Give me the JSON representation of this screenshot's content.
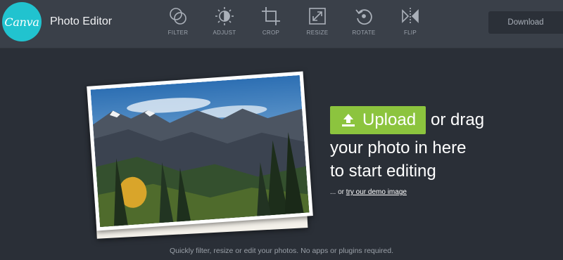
{
  "header": {
    "logo_text": "Canva",
    "app_title": "Photo Editor",
    "download_label": "Download",
    "colors": {
      "logo": "#21c3cf",
      "bar": "#3a4049"
    }
  },
  "tools": [
    {
      "label": "FILTER",
      "icon": "filter-icon"
    },
    {
      "label": "ADJUST",
      "icon": "adjust-icon"
    },
    {
      "label": "CROP",
      "icon": "crop-icon"
    },
    {
      "label": "RESIZE",
      "icon": "resize-icon"
    },
    {
      "label": "ROTATE",
      "icon": "rotate-icon"
    },
    {
      "label": "FLIP",
      "icon": "flip-icon"
    }
  ],
  "main": {
    "upload_label": "Upload",
    "line1": "or drag",
    "line2": "your photo in here",
    "line3": "to start editing",
    "demo_prefix": "... or ",
    "demo_link": "try our demo image",
    "footnote": "Quickly filter, resize or edit your photos. No apps or plugins required.",
    "colors": {
      "upload": "#8cc43e",
      "background": "#2a2f37"
    }
  }
}
